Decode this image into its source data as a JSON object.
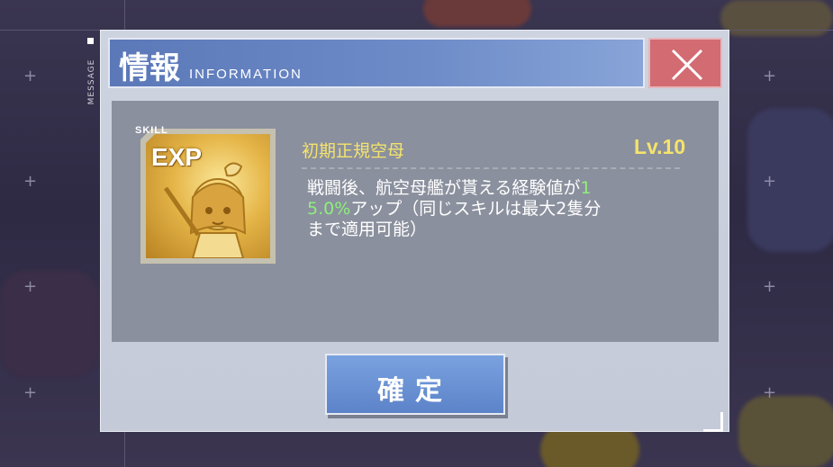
{
  "side_tab": {
    "label": "MESSAGE"
  },
  "dialog": {
    "title_jp": "情報",
    "title_en": "INFORMATION",
    "close_icon": "close-x-icon"
  },
  "skill": {
    "badge_label": "SKILL",
    "icon_text": "EXP",
    "name": "初期正規空母",
    "level": "Lv.10",
    "desc_part1": "戦闘後、航空母艦が貰える経験値が",
    "desc_highlight_a": "1",
    "desc_highlight_b": "5.0%",
    "desc_part2": "アップ（同じスキルは最大2隻分",
    "desc_part3": "まで適用可能）"
  },
  "buttons": {
    "confirm": "確定"
  },
  "colors": {
    "header": "#6e8cc8",
    "close": "#d36b73",
    "accent_text": "#f4e36c",
    "highlight": "#8ef07a",
    "confirm": "#6a92d4"
  }
}
